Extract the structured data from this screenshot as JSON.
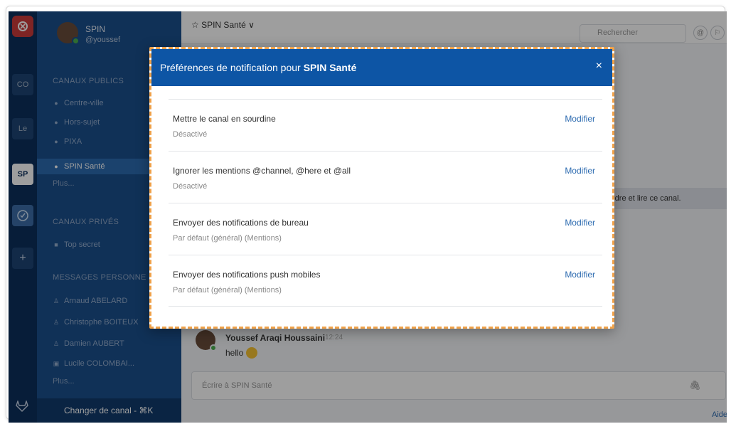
{
  "teams": [
    {
      "label": "CO"
    },
    {
      "label": "Le"
    },
    {
      "label": "SP"
    }
  ],
  "user": {
    "name": "SPIN",
    "handle": "@youssef"
  },
  "sidebar": {
    "public_title": "CANAUX PUBLICS",
    "public_channels": [
      {
        "label": "Centre-ville"
      },
      {
        "label": "Hors-sujet"
      },
      {
        "label": "PIXA"
      },
      {
        "label": "SPIN Santé"
      }
    ],
    "public_more": "Plus...",
    "private_title": "CANAUX PRIVÉS",
    "private_channels": [
      {
        "label": "Top secret"
      }
    ],
    "dm_title": "MESSAGES PERSONNE",
    "dms": [
      {
        "label": "Arnaud ABELARD"
      },
      {
        "label": "Christophe BOITEUX"
      },
      {
        "label": "Damien AUBERT"
      },
      {
        "label": "Lucile COLOMBAI..."
      }
    ],
    "dm_more": "Plus...",
    "switch_channel": "Changer de canal - ⌘K"
  },
  "main": {
    "channel_title": "☆ SPIN Santé ∨",
    "search_placeholder": "Rechercher",
    "join_text": "oindre et lire ce canal.",
    "post": {
      "author": "Youssef Araqi Houssaini",
      "time": "12:24",
      "message": "hello"
    },
    "composer_placeholder": "Écrire à SPIN Santé",
    "help": "Aide"
  },
  "modal": {
    "title_prefix": "Préférences de notification pour",
    "title_channel": "SPIN Santé",
    "close": "×",
    "rows": [
      {
        "title": "Mettre le canal en sourdine",
        "value": "Désactivé",
        "action": "Modifier"
      },
      {
        "title": "Ignorer les mentions @channel, @here et @all",
        "value": "Désactivé",
        "action": "Modifier"
      },
      {
        "title": "Envoyer des notifications de bureau",
        "value": "Par défaut (général) (Mentions)",
        "action": "Modifier"
      },
      {
        "title": "Envoyer des notifications push mobiles",
        "value": "Par défaut (général) (Mentions)",
        "action": "Modifier"
      }
    ]
  }
}
